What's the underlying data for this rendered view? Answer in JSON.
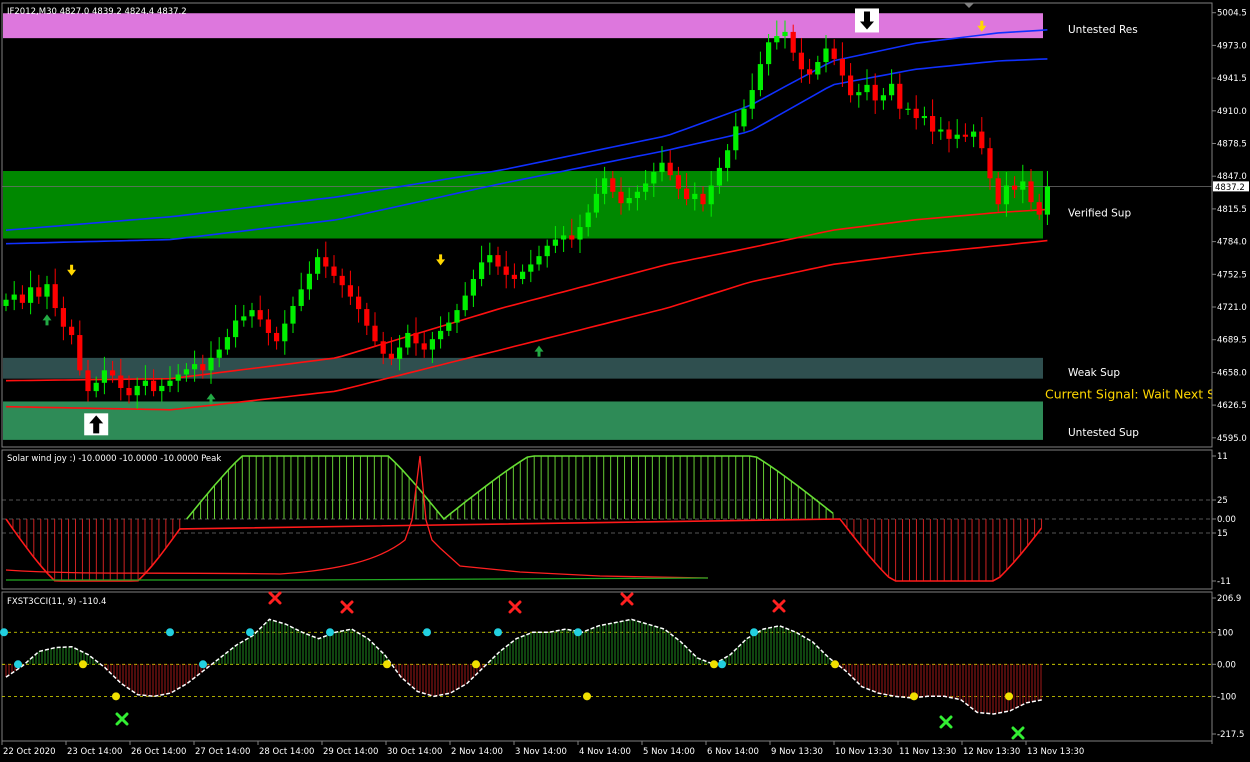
{
  "chart_data": {
    "type": "candlestick",
    "main": {
      "title": "IF2012,M30  4827.0 4839.2 4824.4 4837.2",
      "ylim": [
        4590,
        5010
      ],
      "y_ticks": [
        "5004.5",
        "4973.0",
        "4941.5",
        "4910.0",
        "4878.5",
        "4847.0",
        "4815.5",
        "4784.0",
        "4752.5",
        "4721.0",
        "4689.5",
        "4658.0",
        "4626.5",
        "4595.0"
      ],
      "current_price": "4837.2",
      "signal_text": "Current Signal: Wait Next Signal",
      "zones": [
        {
          "label": "Untested Res",
          "from": 4980,
          "to": 5004,
          "color": "#dd77dd"
        },
        {
          "label": "Verified Sup",
          "from": 4787,
          "to": 4852,
          "color": "#008800"
        },
        {
          "label": "Weak Sup",
          "from": 4652,
          "to": 4672,
          "color": "#2f4f4f"
        },
        {
          "label": "Untested Sup",
          "from": 4593,
          "to": 4630,
          "color": "#2e8b57"
        }
      ],
      "closes": [
        4728,
        4733,
        4725,
        4740,
        4731,
        4743,
        4720,
        4702,
        4694,
        4660,
        4640,
        4648,
        4660,
        4655,
        4643,
        4636,
        4645,
        4650,
        4640,
        4645,
        4650,
        4656,
        4661,
        4666,
        4660,
        4672,
        4680,
        4692,
        4708,
        4712,
        4718,
        4709,
        4696,
        4688,
        4705,
        4722,
        4738,
        4753,
        4769,
        4760,
        4751,
        4742,
        4731,
        4719,
        4703,
        4688,
        4676,
        4671,
        4682,
        4696,
        4686,
        4680,
        4690,
        4698,
        4706,
        4718,
        4732,
        4748,
        4764,
        4771,
        4760,
        4752,
        4748,
        4755,
        4762,
        4770,
        4780,
        4786,
        4790,
        4786,
        4798,
        4812,
        4830,
        4845,
        4832,
        4821,
        4826,
        4832,
        4840,
        4851,
        4860,
        4848,
        4835,
        4825,
        4830,
        4820,
        4838,
        4855,
        4872,
        4895,
        4912,
        4930,
        4955,
        4976,
        4982,
        4986,
        4966,
        4950,
        4945,
        4957,
        4970,
        4960,
        4944,
        4925,
        4928,
        4935,
        4920,
        4925,
        4936,
        4912,
        4912,
        4903,
        4905,
        4890,
        4892,
        4883,
        4887,
        4885,
        4890,
        4874,
        4845,
        4820,
        4838,
        4834,
        4842,
        4822,
        4810,
        4837
      ],
      "open_idx": [
        4,
        14,
        25,
        36,
        47,
        58,
        69,
        80,
        91,
        100,
        111,
        122
      ],
      "bands": [
        {
          "name": "upper_outer",
          "color": "#1030ff",
          "anchors": [
            [
              0,
              4795
            ],
            [
              20,
              4808
            ],
            [
              40,
              4827
            ],
            [
              60,
              4853
            ],
            [
              80,
              4886
            ],
            [
              90,
              4915
            ],
            [
              100,
              4958
            ],
            [
              110,
              4975
            ],
            [
              120,
              4985
            ],
            [
              126,
              4988
            ]
          ]
        },
        {
          "name": "upper_inner",
          "color": "#1030ff",
          "anchors": [
            [
              0,
              4782
            ],
            [
              20,
              4786
            ],
            [
              40,
              4805
            ],
            [
              60,
              4840
            ],
            [
              80,
              4872
            ],
            [
              90,
              4890
            ],
            [
              100,
              4935
            ],
            [
              110,
              4950
            ],
            [
              120,
              4958
            ],
            [
              126,
              4960
            ]
          ]
        },
        {
          "name": "lower_inner",
          "color": "#ff1010",
          "anchors": [
            [
              0,
              4650
            ],
            [
              20,
              4652
            ],
            [
              40,
              4672
            ],
            [
              60,
              4720
            ],
            [
              80,
              4762
            ],
            [
              90,
              4778
            ],
            [
              100,
              4795
            ],
            [
              110,
              4805
            ],
            [
              120,
              4812
            ],
            [
              126,
              4815
            ]
          ]
        },
        {
          "name": "lower_outer",
          "color": "#ff1010",
          "anchors": [
            [
              0,
              4625
            ],
            [
              20,
              4622
            ],
            [
              40,
              4640
            ],
            [
              60,
              4680
            ],
            [
              80,
              4720
            ],
            [
              90,
              4745
            ],
            [
              100,
              4762
            ],
            [
              110,
              4772
            ],
            [
              120,
              4780
            ],
            [
              126,
              4785
            ]
          ]
        }
      ],
      "markers": [
        {
          "type": "arrow_down_yellow",
          "i": 8,
          "p": 4755
        },
        {
          "type": "arrow_down_yellow",
          "i": 53,
          "p": 4765
        },
        {
          "type": "arrow_down_yellow",
          "i": 119,
          "p": 4990
        },
        {
          "type": "arrow_up_green",
          "i": 5,
          "p": 4710
        },
        {
          "type": "arrow_up_green",
          "i": 25,
          "p": 4634
        },
        {
          "type": "arrow_up_green",
          "i": 65,
          "p": 4680
        },
        {
          "type": "boxed_up",
          "i": 11,
          "p": 4608
        },
        {
          "type": "boxed_down",
          "i": 105,
          "p": 4998
        }
      ]
    },
    "sub1": {
      "title": "Solar wind joy :) -10.0000 -10.0000 -10.0000  Peak",
      "y_ticks": [
        "11",
        "25",
        "0.00",
        "15",
        "-11"
      ],
      "histogram": [
        {
          "from": 0,
          "to": 26,
          "sign": "neg",
          "peak": 0.95
        },
        {
          "from": 26,
          "to": 63,
          "sign": "pos",
          "peak": 1.0
        },
        {
          "from": 63,
          "to": 120,
          "sign": "pos",
          "peak": 1.0
        },
        {
          "from": 120,
          "to": 150,
          "sign": "neg",
          "peak": 1.0
        }
      ]
    },
    "sub2": {
      "title": "FXST3CCI(11, 9) -110.4",
      "y_ticks": [
        "206.9",
        "100",
        "0.00",
        "-100",
        "-217.5"
      ],
      "levels": [
        100,
        0,
        -100
      ],
      "cci": [
        -40,
        -5,
        40,
        52,
        55,
        30,
        -10,
        -60,
        -95,
        -100,
        -90,
        -60,
        -20,
        20,
        60,
        90,
        140,
        125,
        100,
        80,
        100,
        110,
        80,
        30,
        -40,
        -85,
        -100,
        -90,
        -60,
        -10,
        40,
        80,
        100,
        100,
        110,
        100,
        120,
        130,
        140,
        125,
        110,
        70,
        20,
        0,
        30,
        80,
        110,
        120,
        100,
        70,
        20,
        -20,
        -70,
        -90,
        -100,
        -105,
        -100,
        -100,
        -110,
        -150,
        -155,
        -145,
        -120,
        -110
      ],
      "markers": [
        {
          "i": 15,
          "v": 240,
          "type": "sell_x"
        },
        {
          "i": 18,
          "v": 210,
          "type": "buy_x"
        }
      ]
    },
    "x_labels": [
      "22 Oct 2020",
      "23 Oct 14:00",
      "26 Oct 14:00",
      "27 Oct 14:00",
      "28 Oct 14:00",
      "29 Oct 14:00",
      "30 Oct 14:00",
      "2 Nov 14:00",
      "3 Nov 14:00",
      "4 Nov 14:00",
      "5 Nov 14:00",
      "6 Nov 14:00",
      "9 Nov 13:30",
      "10 Nov 13:30",
      "11 Nov 13:30",
      "12 Nov 13:30",
      "13 Nov 13:30"
    ]
  }
}
